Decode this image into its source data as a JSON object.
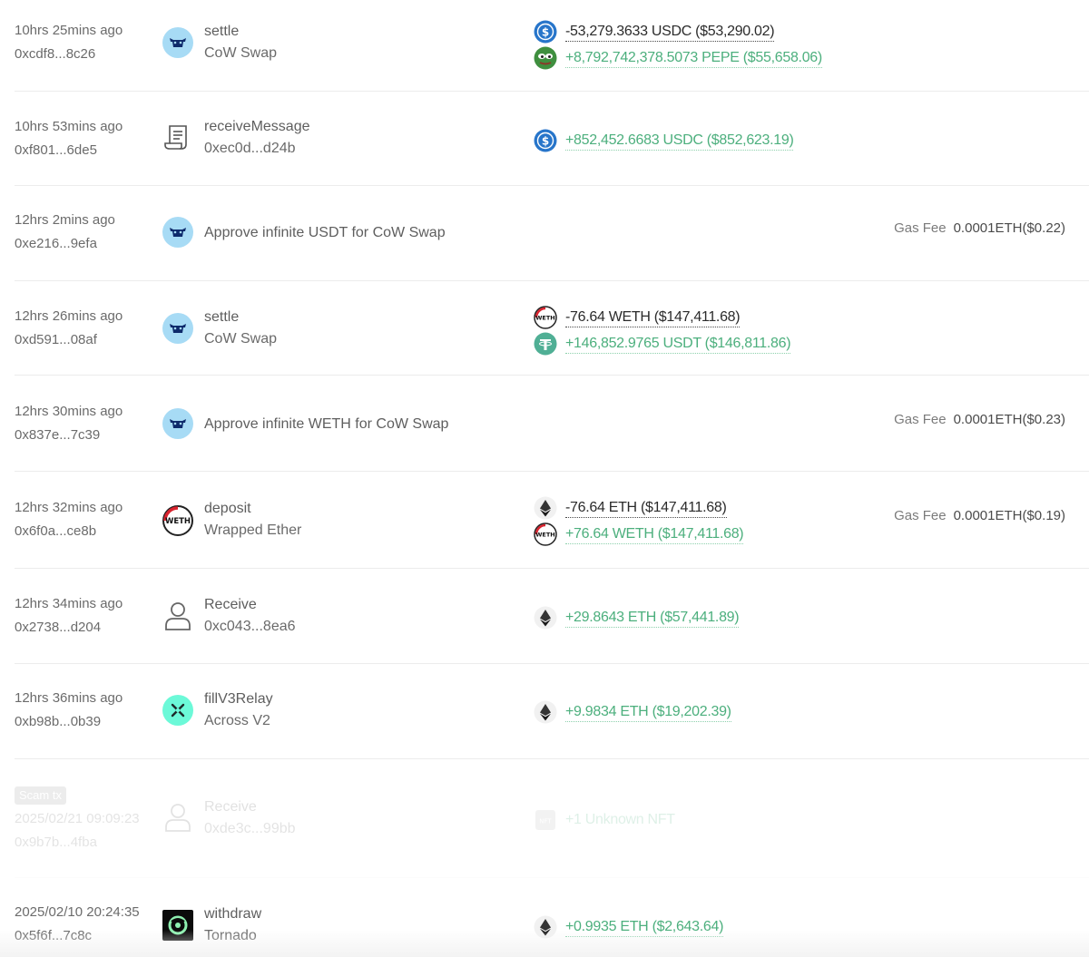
{
  "transactions": [
    {
      "time": "10hrs 25mins ago",
      "hash": "0xcdf8...8c26",
      "icon": "cow-icon",
      "title": "settle",
      "subtitle": "CoW Swap",
      "tokens": [
        {
          "icon": "usdc-icon",
          "amount": "-53,279.3633 USDC ($53,290.02)",
          "sign": "neg"
        },
        {
          "icon": "pepe-icon",
          "amount": "+8,792,742,378.5073 PEPE ($55,658.06)",
          "sign": "pos"
        }
      ]
    },
    {
      "time": "10hrs 53mins ago",
      "hash": "0xf801...6de5",
      "icon": "contract-icon",
      "title": "receiveMessage",
      "subtitle": "0xec0d...d24b",
      "tokens": [
        {
          "icon": "usdc-icon",
          "amount": "+852,452.6683 USDC ($852,623.19)",
          "sign": "pos"
        }
      ]
    },
    {
      "time": "12hrs 2mins ago",
      "hash": "0xe216...9efa",
      "icon": "cow-icon",
      "title": "Approve infinite USDT for CoW Swap",
      "subtitle": "",
      "gas_label": "Gas Fee",
      "gas_value": "0.0001ETH($0.22)"
    },
    {
      "time": "12hrs 26mins ago",
      "hash": "0xd591...08af",
      "icon": "cow-icon",
      "title": "settle",
      "subtitle": "CoW Swap",
      "tokens": [
        {
          "icon": "weth-icon",
          "amount": "-76.64 WETH ($147,411.68)",
          "sign": "neg"
        },
        {
          "icon": "usdt-icon",
          "amount": "+146,852.9765 USDT ($146,811.86)",
          "sign": "pos"
        }
      ]
    },
    {
      "time": "12hrs 30mins ago",
      "hash": "0x837e...7c39",
      "icon": "cow-icon",
      "title": "Approve infinite WETH for CoW Swap",
      "subtitle": "",
      "gas_label": "Gas Fee",
      "gas_value": "0.0001ETH($0.23)"
    },
    {
      "time": "12hrs 32mins ago",
      "hash": "0x6f0a...ce8b",
      "icon": "weth-icon",
      "title": "deposit",
      "subtitle": "Wrapped Ether",
      "tokens": [
        {
          "icon": "eth-icon",
          "amount": "-76.64 ETH ($147,411.68)",
          "sign": "neg"
        },
        {
          "icon": "weth-icon",
          "amount": "+76.64 WETH ($147,411.68)",
          "sign": "pos"
        }
      ],
      "gas_label": "Gas Fee",
      "gas_value": "0.0001ETH($0.19)"
    },
    {
      "time": "12hrs 34mins ago",
      "hash": "0x2738...d204",
      "icon": "person-icon",
      "title": "Receive",
      "subtitle": "0xc043...8ea6",
      "tokens": [
        {
          "icon": "eth-icon",
          "amount": "+29.8643 ETH ($57,441.89)",
          "sign": "pos"
        }
      ]
    },
    {
      "time": "12hrs 36mins ago",
      "hash": "0xb98b...0b39",
      "icon": "across-icon",
      "title": "fillV3Relay",
      "subtitle": "Across V2",
      "tokens": [
        {
          "icon": "eth-icon",
          "amount": "+9.9834 ETH ($19,202.39)",
          "sign": "pos"
        }
      ]
    },
    {
      "badge": "Scam tx",
      "time": "2025/02/21 09:09:23",
      "hash": "0x9b7b...4fba",
      "icon": "person-icon",
      "title": "Receive",
      "subtitle": "0xde3c...99bb",
      "tokens": [
        {
          "icon": "nft-icon",
          "amount": "+1 Unknown NFT",
          "sign": "pos"
        }
      ]
    },
    {
      "time": "2025/02/10 20:24:35",
      "hash": "0x5f6f...7c8c",
      "icon": "tornado-icon",
      "title": "withdraw",
      "subtitle": "Tornado",
      "tokens": [
        {
          "icon": "eth-icon",
          "amount": "+0.9935 ETH ($2,643.64)",
          "sign": "pos"
        }
      ]
    }
  ]
}
